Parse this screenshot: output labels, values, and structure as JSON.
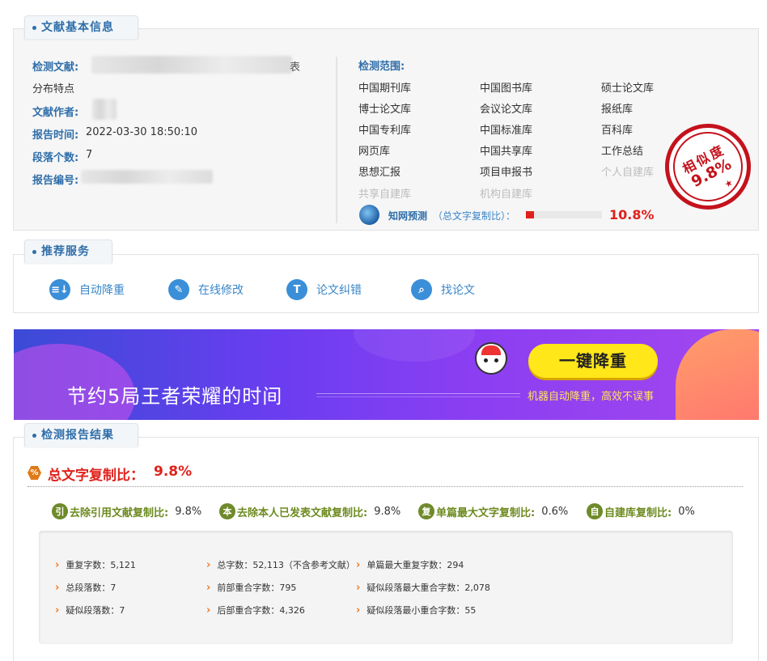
{
  "basic_info": {
    "tab_label": "文献基本信息",
    "doc_label": "检测文献:",
    "doc_suffix": "表",
    "doc_line2": "分布特点",
    "author_label": "文献作者:",
    "report_time_label": "报告时间:",
    "report_time": "2022-03-30 18:50:10",
    "paragraphs_label": "段落个数:",
    "paragraphs": "7",
    "report_no_label": "报告编号:",
    "scope_label": "检测范围:",
    "databases": [
      {
        "name": "中国期刊库",
        "enabled": true
      },
      {
        "name": "中国图书库",
        "enabled": true
      },
      {
        "name": "硕士论文库",
        "enabled": true
      },
      {
        "name": "博士论文库",
        "enabled": true
      },
      {
        "name": "会议论文库",
        "enabled": true
      },
      {
        "name": "报纸库",
        "enabled": true
      },
      {
        "name": "中国专利库",
        "enabled": true
      },
      {
        "name": "中国标准库",
        "enabled": true
      },
      {
        "name": "百科库",
        "enabled": true
      },
      {
        "name": "网页库",
        "enabled": true
      },
      {
        "name": "中国共享库",
        "enabled": true
      },
      {
        "name": "工作总结",
        "enabled": true
      },
      {
        "name": "思想汇报",
        "enabled": true
      },
      {
        "name": "项目申报书",
        "enabled": true
      },
      {
        "name": "个人自建库",
        "enabled": false
      },
      {
        "name": "共享自建库",
        "enabled": false
      },
      {
        "name": "机构自建库",
        "enabled": false
      }
    ],
    "cnki_label": "知网预测",
    "cnki_desc": "（总文字复制比）：",
    "cnki_value": "10.8%",
    "cnki_fraction": 0.108,
    "stamp_label": "相似度",
    "stamp_value": "9.8%"
  },
  "services": {
    "tab_label": "推荐服务",
    "items": [
      {
        "label": "自动降重",
        "icon": "auto-reduce-icon"
      },
      {
        "label": "在线修改",
        "icon": "pencil-icon"
      },
      {
        "label": "论文纠错",
        "icon": "text-t-icon"
      },
      {
        "label": "找论文",
        "icon": "search-icon"
      }
    ]
  },
  "banner": {
    "headline": "节约5局王者荣耀的时间",
    "button": "一键降重",
    "subtitle": "机器自动降重，高效不误事"
  },
  "result": {
    "tab_label": "检测报告结果",
    "total_label": "总文字复制比：",
    "total_value": "9.8%",
    "rates": [
      {
        "icon_char": "引",
        "label": "去除引用文献复制比:",
        "value": "9.8%"
      },
      {
        "icon_char": "本",
        "label": "去除本人已发表文献复制比:",
        "value": "9.8%"
      },
      {
        "icon_char": "复",
        "label": "单篇最大文字复制比:",
        "value": "0.6%"
      },
      {
        "icon_char": "自",
        "label": "自建库复制比:",
        "value": "0%"
      }
    ],
    "stats": [
      [
        "重复字数：5,121",
        "总字数：52,113（不含参考文献）",
        "单篇最大重复字数：294"
      ],
      [
        "总段落数：7",
        "前部重合字数：795",
        "疑似段落最大重合字数：2,078"
      ],
      [
        "疑似段落数：7",
        "后部重合字数：4,326",
        "疑似段落最小重合字数：55"
      ]
    ]
  },
  "colors": {
    "accent": "#2f6ea9",
    "red": "#e0211b",
    "green": "#6c8a1e",
    "stamp": "#c4121c"
  }
}
